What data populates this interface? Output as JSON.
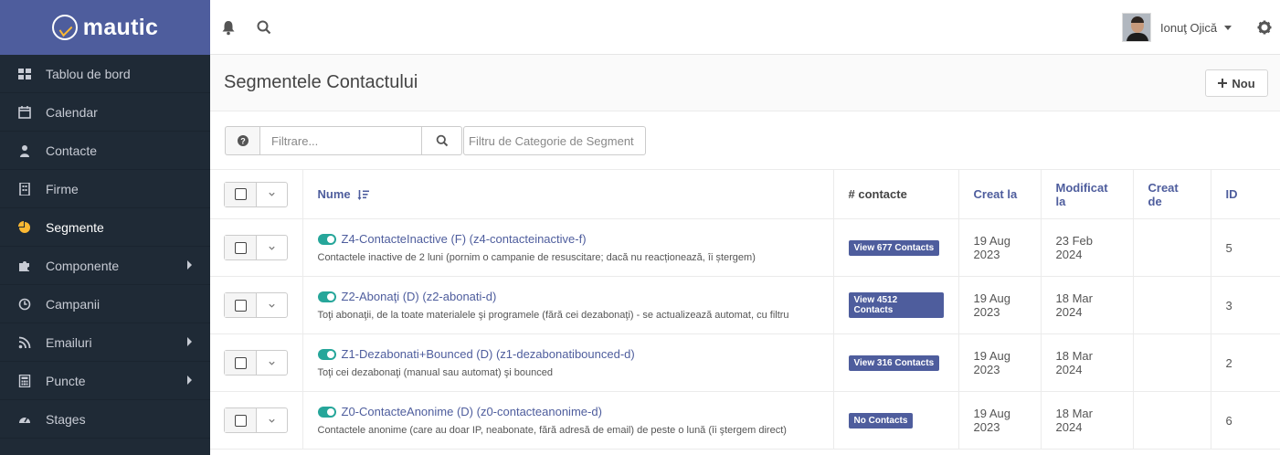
{
  "brand": {
    "name": "mautic"
  },
  "sidebar": {
    "items": [
      {
        "label": "Tablou de bord",
        "icon": "dashboard-icon",
        "caret": false
      },
      {
        "label": "Calendar",
        "icon": "calendar-icon",
        "caret": false
      },
      {
        "label": "Contacte",
        "icon": "user-icon",
        "caret": false
      },
      {
        "label": "Firme",
        "icon": "building-icon",
        "caret": false
      },
      {
        "label": "Segmente",
        "icon": "pie-chart-icon",
        "caret": false,
        "active": true
      },
      {
        "label": "Componente",
        "icon": "puzzle-icon",
        "caret": true
      },
      {
        "label": "Campanii",
        "icon": "clock-icon",
        "caret": false
      },
      {
        "label": "Emailuri",
        "icon": "rss-icon",
        "caret": true
      },
      {
        "label": "Puncte",
        "icon": "calculator-icon",
        "caret": true
      },
      {
        "label": "Stages",
        "icon": "tachometer-icon",
        "caret": false
      }
    ]
  },
  "topbar": {
    "user_name": "Ionuţ Ojică"
  },
  "page": {
    "title": "Segmentele Contactului",
    "new_button": "Nou"
  },
  "filter": {
    "placeholder": "Filtrare...",
    "category_placeholder": "Filtru de Categorie de Segment"
  },
  "table": {
    "headers": {
      "name": "Nume",
      "contacts": "# contacte",
      "created": "Creat la",
      "modified": "Modificat la",
      "created_by": "Creat de",
      "id": "ID"
    },
    "rows": [
      {
        "title": "Z4-ContacteInactive (F) (z4-contacteinactive-f)",
        "description": "Contactele inactive de 2 luni (pornim o campanie de resuscitare; dacă nu reacționează, îi ștergem)",
        "contacts": "View 677 Contacts",
        "created_day": "19 Aug",
        "created_year": "2023",
        "modified_day": "23 Feb",
        "modified_year": "2024",
        "created_by": "",
        "id": "5"
      },
      {
        "title": "Z2-Abonaţi (D) (z2-abonati-d)",
        "description": "Toţi abonaţii, de la toate materialele şi programele (fără cei dezabonaţi) - se actualizează automat, cu filtru",
        "contacts": "View 4512 Contacts",
        "created_day": "19 Aug",
        "created_year": "2023",
        "modified_day": "18 Mar",
        "modified_year": "2024",
        "created_by": "",
        "id": "3"
      },
      {
        "title": "Z1-Dezabonati+Bounced (D) (z1-dezabonatibounced-d)",
        "description": "Toţi cei dezabonaţi (manual sau automat) şi bounced",
        "contacts": "View 316 Contacts",
        "created_day": "19 Aug",
        "created_year": "2023",
        "modified_day": "18 Mar",
        "modified_year": "2024",
        "created_by": "",
        "id": "2"
      },
      {
        "title": "Z0-ContacteAnonime (D) (z0-contacteanonime-d)",
        "description": "Contactele anonime (care au doar IP, neabonate, fără adresă de email) de peste o lună (îi ştergem direct)",
        "contacts": "No Contacts",
        "created_day": "19 Aug",
        "created_year": "2023",
        "modified_day": "18 Mar",
        "modified_year": "2024",
        "created_by": "",
        "id": "6"
      }
    ]
  },
  "colors": {
    "brand": "#4e5d9d",
    "sidebar": "#1f2a36",
    "accent": "#fdb933",
    "toggle": "#26a69a"
  }
}
